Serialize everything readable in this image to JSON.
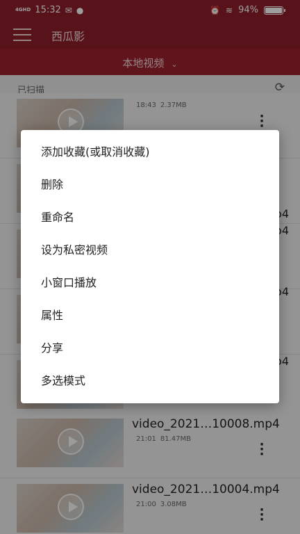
{
  "status_bar": {
    "network": "4GHD",
    "time": "15:32",
    "battery_percent": "94%",
    "battery_level": 0.94,
    "icons": [
      "signal-icon",
      "mail-icon",
      "message-icon",
      "alarm-icon",
      "wifi-icon",
      "battery-icon"
    ]
  },
  "app_bar": {
    "title": "西瓜影"
  },
  "source_selector": {
    "label": "本地视频"
  },
  "scan_status": {
    "label": "已扫描"
  },
  "video_list": {
    "items": [
      {
        "title": "",
        "time": "18:43",
        "size": "2.37MB"
      },
      {
        "title": "",
        "time": "",
        "size": ""
      },
      {
        "title": "",
        "time": "",
        "size": ""
      },
      {
        "title": "",
        "time": "",
        "size": ""
      },
      {
        "title": "",
        "time": "",
        "size": ""
      },
      {
        "title": "video_2021…10008.mp4",
        "time": "21:01",
        "size": "81.47MB"
      },
      {
        "title": "video_2021…10004.mp4",
        "time": "21:00",
        "size": "3.08MB"
      }
    ]
  },
  "context_menu": {
    "items": [
      "添加收藏(或取消收藏)",
      "删除",
      "重命名",
      "设为私密视频",
      "小窗口播放",
      "属性",
      "分享",
      "多选模式"
    ]
  },
  "peek_text": [
    "p4",
    "p4",
    "p4",
    "p4"
  ]
}
